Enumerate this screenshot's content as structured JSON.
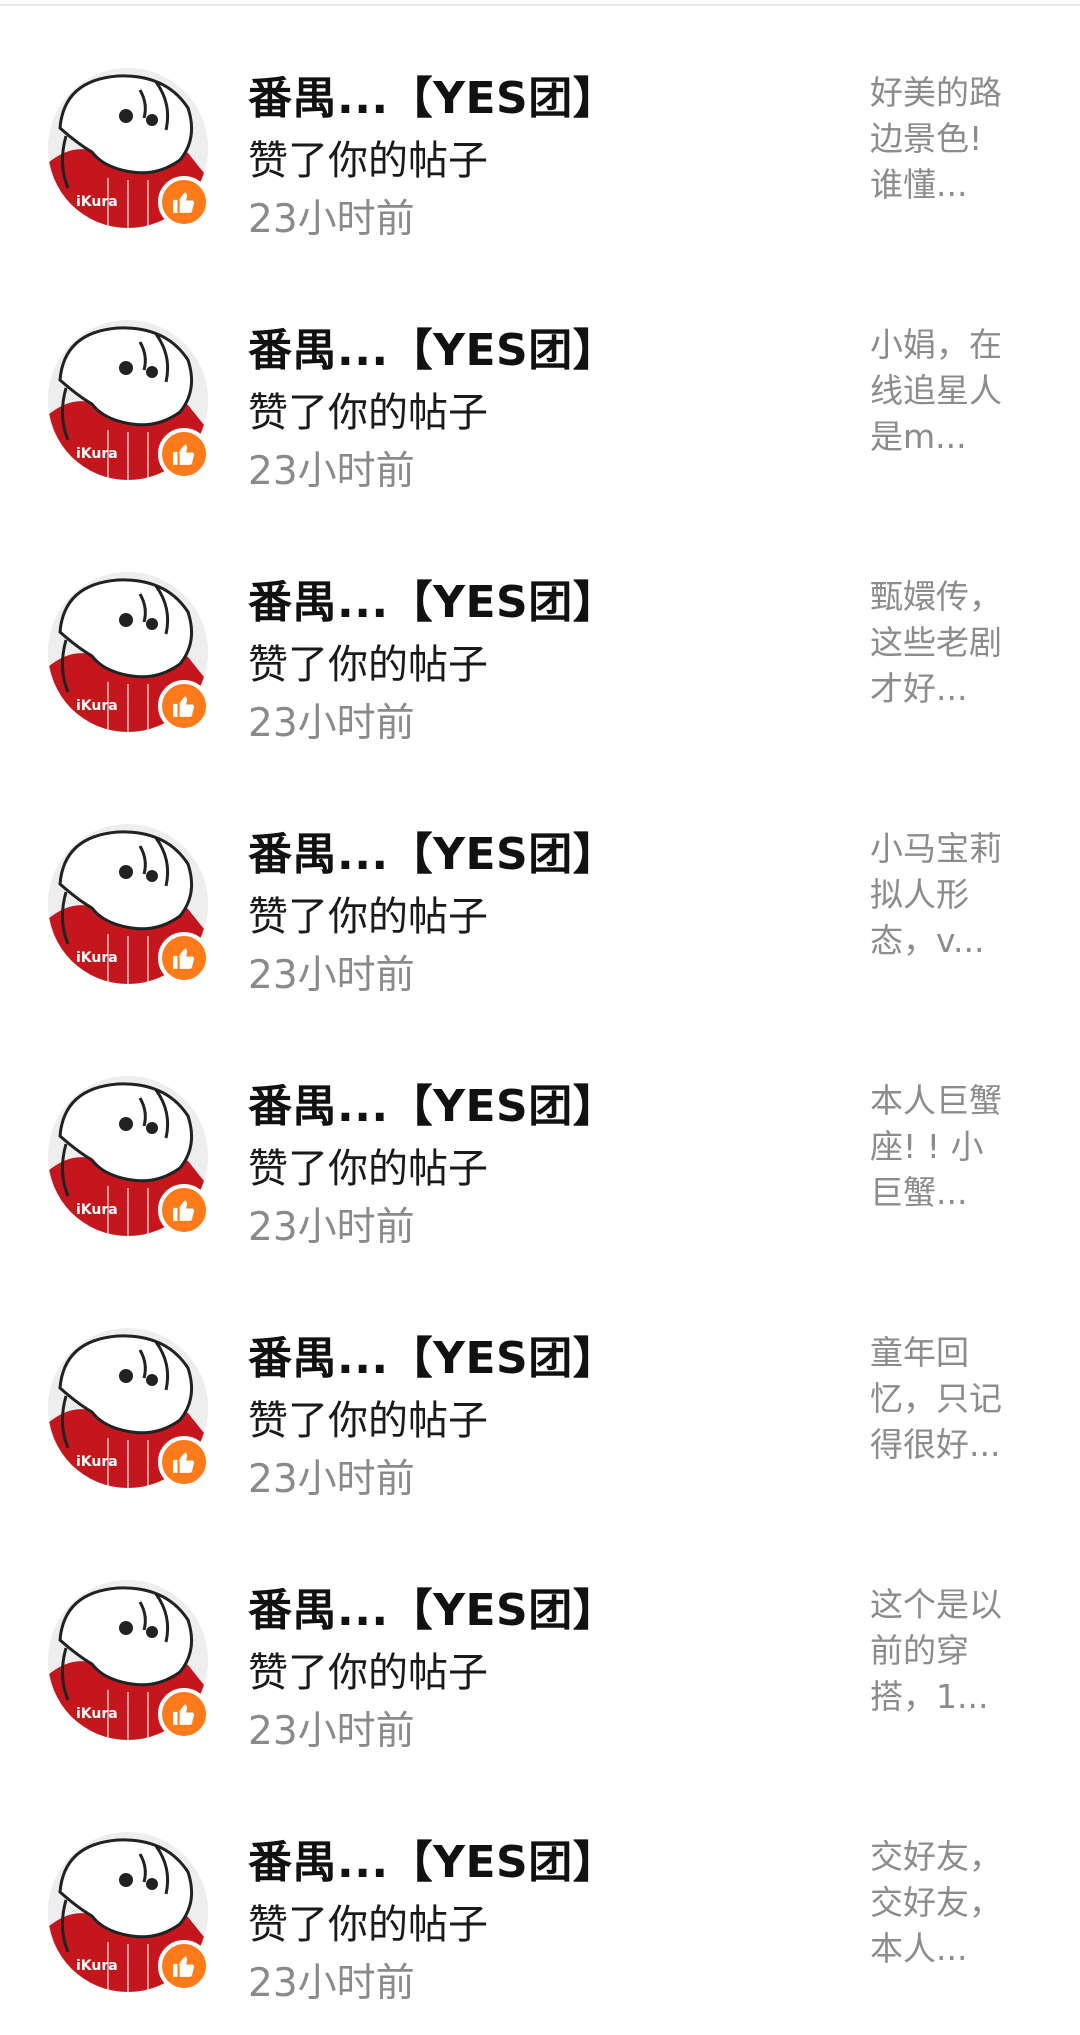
{
  "notifications": [
    {
      "title": "番禺...【YES团】",
      "action": "赞了你的帖子",
      "time": "23小时前",
      "preview_lines": [
        "好美的路",
        "边景色!",
        "谁懂..."
      ]
    },
    {
      "title": "番禺...【YES团】",
      "action": "赞了你的帖子",
      "time": "23小时前",
      "preview_lines": [
        "小娟，在",
        "线追星人",
        "是m..."
      ]
    },
    {
      "title": "番禺...【YES团】",
      "action": "赞了你的帖子",
      "time": "23小时前",
      "preview_lines": [
        "甄嬛传，",
        "这些老剧",
        "才好..."
      ]
    },
    {
      "title": "番禺...【YES团】",
      "action": "赞了你的帖子",
      "time": "23小时前",
      "preview_lines": [
        "小马宝莉",
        "拟人形",
        "态，v..."
      ]
    },
    {
      "title": "番禺...【YES团】",
      "action": "赞了你的帖子",
      "time": "23小时前",
      "preview_lines": [
        "本人巨蟹",
        "座! ! 小",
        "巨蟹..."
      ]
    },
    {
      "title": "番禺...【YES团】",
      "action": "赞了你的帖子",
      "time": "23小时前",
      "preview_lines": [
        "童年回",
        "忆，只记",
        "得很好..."
      ]
    },
    {
      "title": "番禺...【YES团】",
      "action": "赞了你的帖子",
      "time": "23小时前",
      "preview_lines": [
        "这个是以",
        "前的穿",
        "搭，1..."
      ]
    },
    {
      "title": "番禺...【YES团】",
      "action": "赞了你的帖子",
      "time": "23小时前",
      "preview_lines": [
        "交好友，",
        "交好友，",
        "本人..."
      ]
    }
  ],
  "avatar_jersey_text": "iKura",
  "colors": {
    "badge": "#ff7a1a",
    "avatar_red": "#c4161c"
  },
  "icons": {
    "badge": "thumbs-up-icon",
    "avatar": "user-avatar"
  }
}
